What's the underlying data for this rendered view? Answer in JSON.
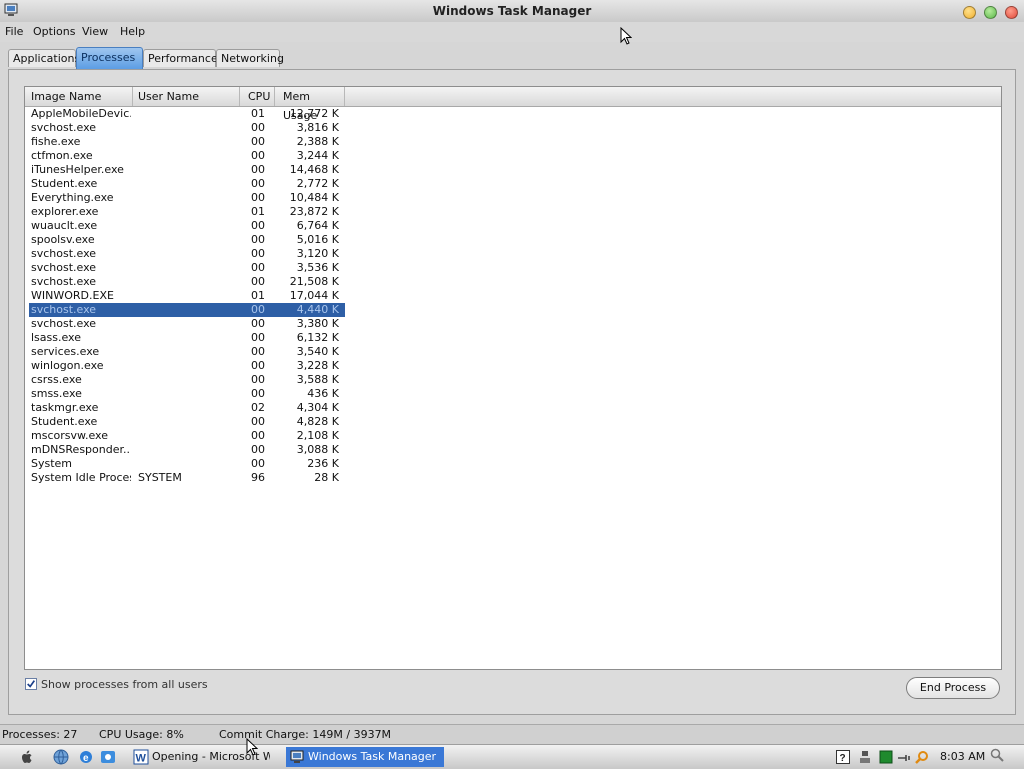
{
  "window": {
    "title": "Windows Task Manager"
  },
  "menu": [
    "File",
    "Options",
    "View",
    "Help"
  ],
  "tabs": [
    {
      "label": "Applications",
      "active": false
    },
    {
      "label": "Processes",
      "active": true
    },
    {
      "label": "Performance",
      "active": false
    },
    {
      "label": "Networking",
      "active": false
    }
  ],
  "columns": {
    "image_name": "Image Name",
    "user_name": "User Name",
    "cpu": "CPU",
    "mem_usage": "Mem Usage"
  },
  "processes": [
    {
      "name": "AppleMobileDevic...",
      "user": "",
      "cpu": "01",
      "mem": "12,772 K"
    },
    {
      "name": "svchost.exe",
      "user": "",
      "cpu": "00",
      "mem": "3,816 K"
    },
    {
      "name": "fishe.exe",
      "user": "",
      "cpu": "00",
      "mem": "2,388 K"
    },
    {
      "name": "ctfmon.exe",
      "user": "",
      "cpu": "00",
      "mem": "3,244 K"
    },
    {
      "name": "iTunesHelper.exe",
      "user": "",
      "cpu": "00",
      "mem": "14,468 K"
    },
    {
      "name": "Student.exe",
      "user": "",
      "cpu": "00",
      "mem": "2,772 K"
    },
    {
      "name": "Everything.exe",
      "user": "",
      "cpu": "00",
      "mem": "10,484 K"
    },
    {
      "name": "explorer.exe",
      "user": "",
      "cpu": "01",
      "mem": "23,872 K"
    },
    {
      "name": "wuauclt.exe",
      "user": "",
      "cpu": "00",
      "mem": "6,764 K"
    },
    {
      "name": "spoolsv.exe",
      "user": "",
      "cpu": "00",
      "mem": "5,016 K"
    },
    {
      "name": "svchost.exe",
      "user": "",
      "cpu": "00",
      "mem": "3,120 K"
    },
    {
      "name": "svchost.exe",
      "user": "",
      "cpu": "00",
      "mem": "3,536 K"
    },
    {
      "name": "svchost.exe",
      "user": "",
      "cpu": "00",
      "mem": "21,508 K"
    },
    {
      "name": "WINWORD.EXE",
      "user": "",
      "cpu": "01",
      "mem": "17,044 K"
    },
    {
      "name": "svchost.exe",
      "user": "",
      "cpu": "00",
      "mem": "4,440 K",
      "selected": true
    },
    {
      "name": "svchost.exe",
      "user": "",
      "cpu": "00",
      "mem": "3,380 K"
    },
    {
      "name": "lsass.exe",
      "user": "",
      "cpu": "00",
      "mem": "6,132 K"
    },
    {
      "name": "services.exe",
      "user": "",
      "cpu": "00",
      "mem": "3,540 K"
    },
    {
      "name": "winlogon.exe",
      "user": "",
      "cpu": "00",
      "mem": "3,228 K"
    },
    {
      "name": "csrss.exe",
      "user": "",
      "cpu": "00",
      "mem": "3,588 K"
    },
    {
      "name": "smss.exe",
      "user": "",
      "cpu": "00",
      "mem": "436 K"
    },
    {
      "name": "taskmgr.exe",
      "user": "",
      "cpu": "02",
      "mem": "4,304 K"
    },
    {
      "name": "Student.exe",
      "user": "",
      "cpu": "00",
      "mem": "4,828 K"
    },
    {
      "name": "mscorsvw.exe",
      "user": "",
      "cpu": "00",
      "mem": "2,108 K"
    },
    {
      "name": "mDNSResponder....",
      "user": "",
      "cpu": "00",
      "mem": "3,088 K"
    },
    {
      "name": "System",
      "user": "",
      "cpu": "00",
      "mem": "236 K"
    },
    {
      "name": "System Idle Process",
      "user": "SYSTEM",
      "cpu": "96",
      "mem": "28 K"
    }
  ],
  "show_all_users": {
    "label": "Show processes from all users",
    "checked": true
  },
  "end_process_label": "End Process",
  "status": {
    "processes": "Processes: 27",
    "cpu_usage": "CPU Usage: 8%",
    "commit_charge": "Commit Charge: 149M / 3937M"
  },
  "taskbar": {
    "tasks": [
      {
        "label": "Opening - Microsoft W...",
        "active": false,
        "icon": "word-icon"
      },
      {
        "label": "Windows Task Manager",
        "active": true,
        "icon": "task-manager-icon"
      }
    ],
    "clock": "8:03 AM"
  },
  "colors": {
    "selection": "#2e5fa6",
    "active_tab": "#5c9de4",
    "active_task": "#3a78d6",
    "close_button": "#e04a3a",
    "minimize_button": "#f0b030",
    "maximize_button": "#5cb84a"
  }
}
